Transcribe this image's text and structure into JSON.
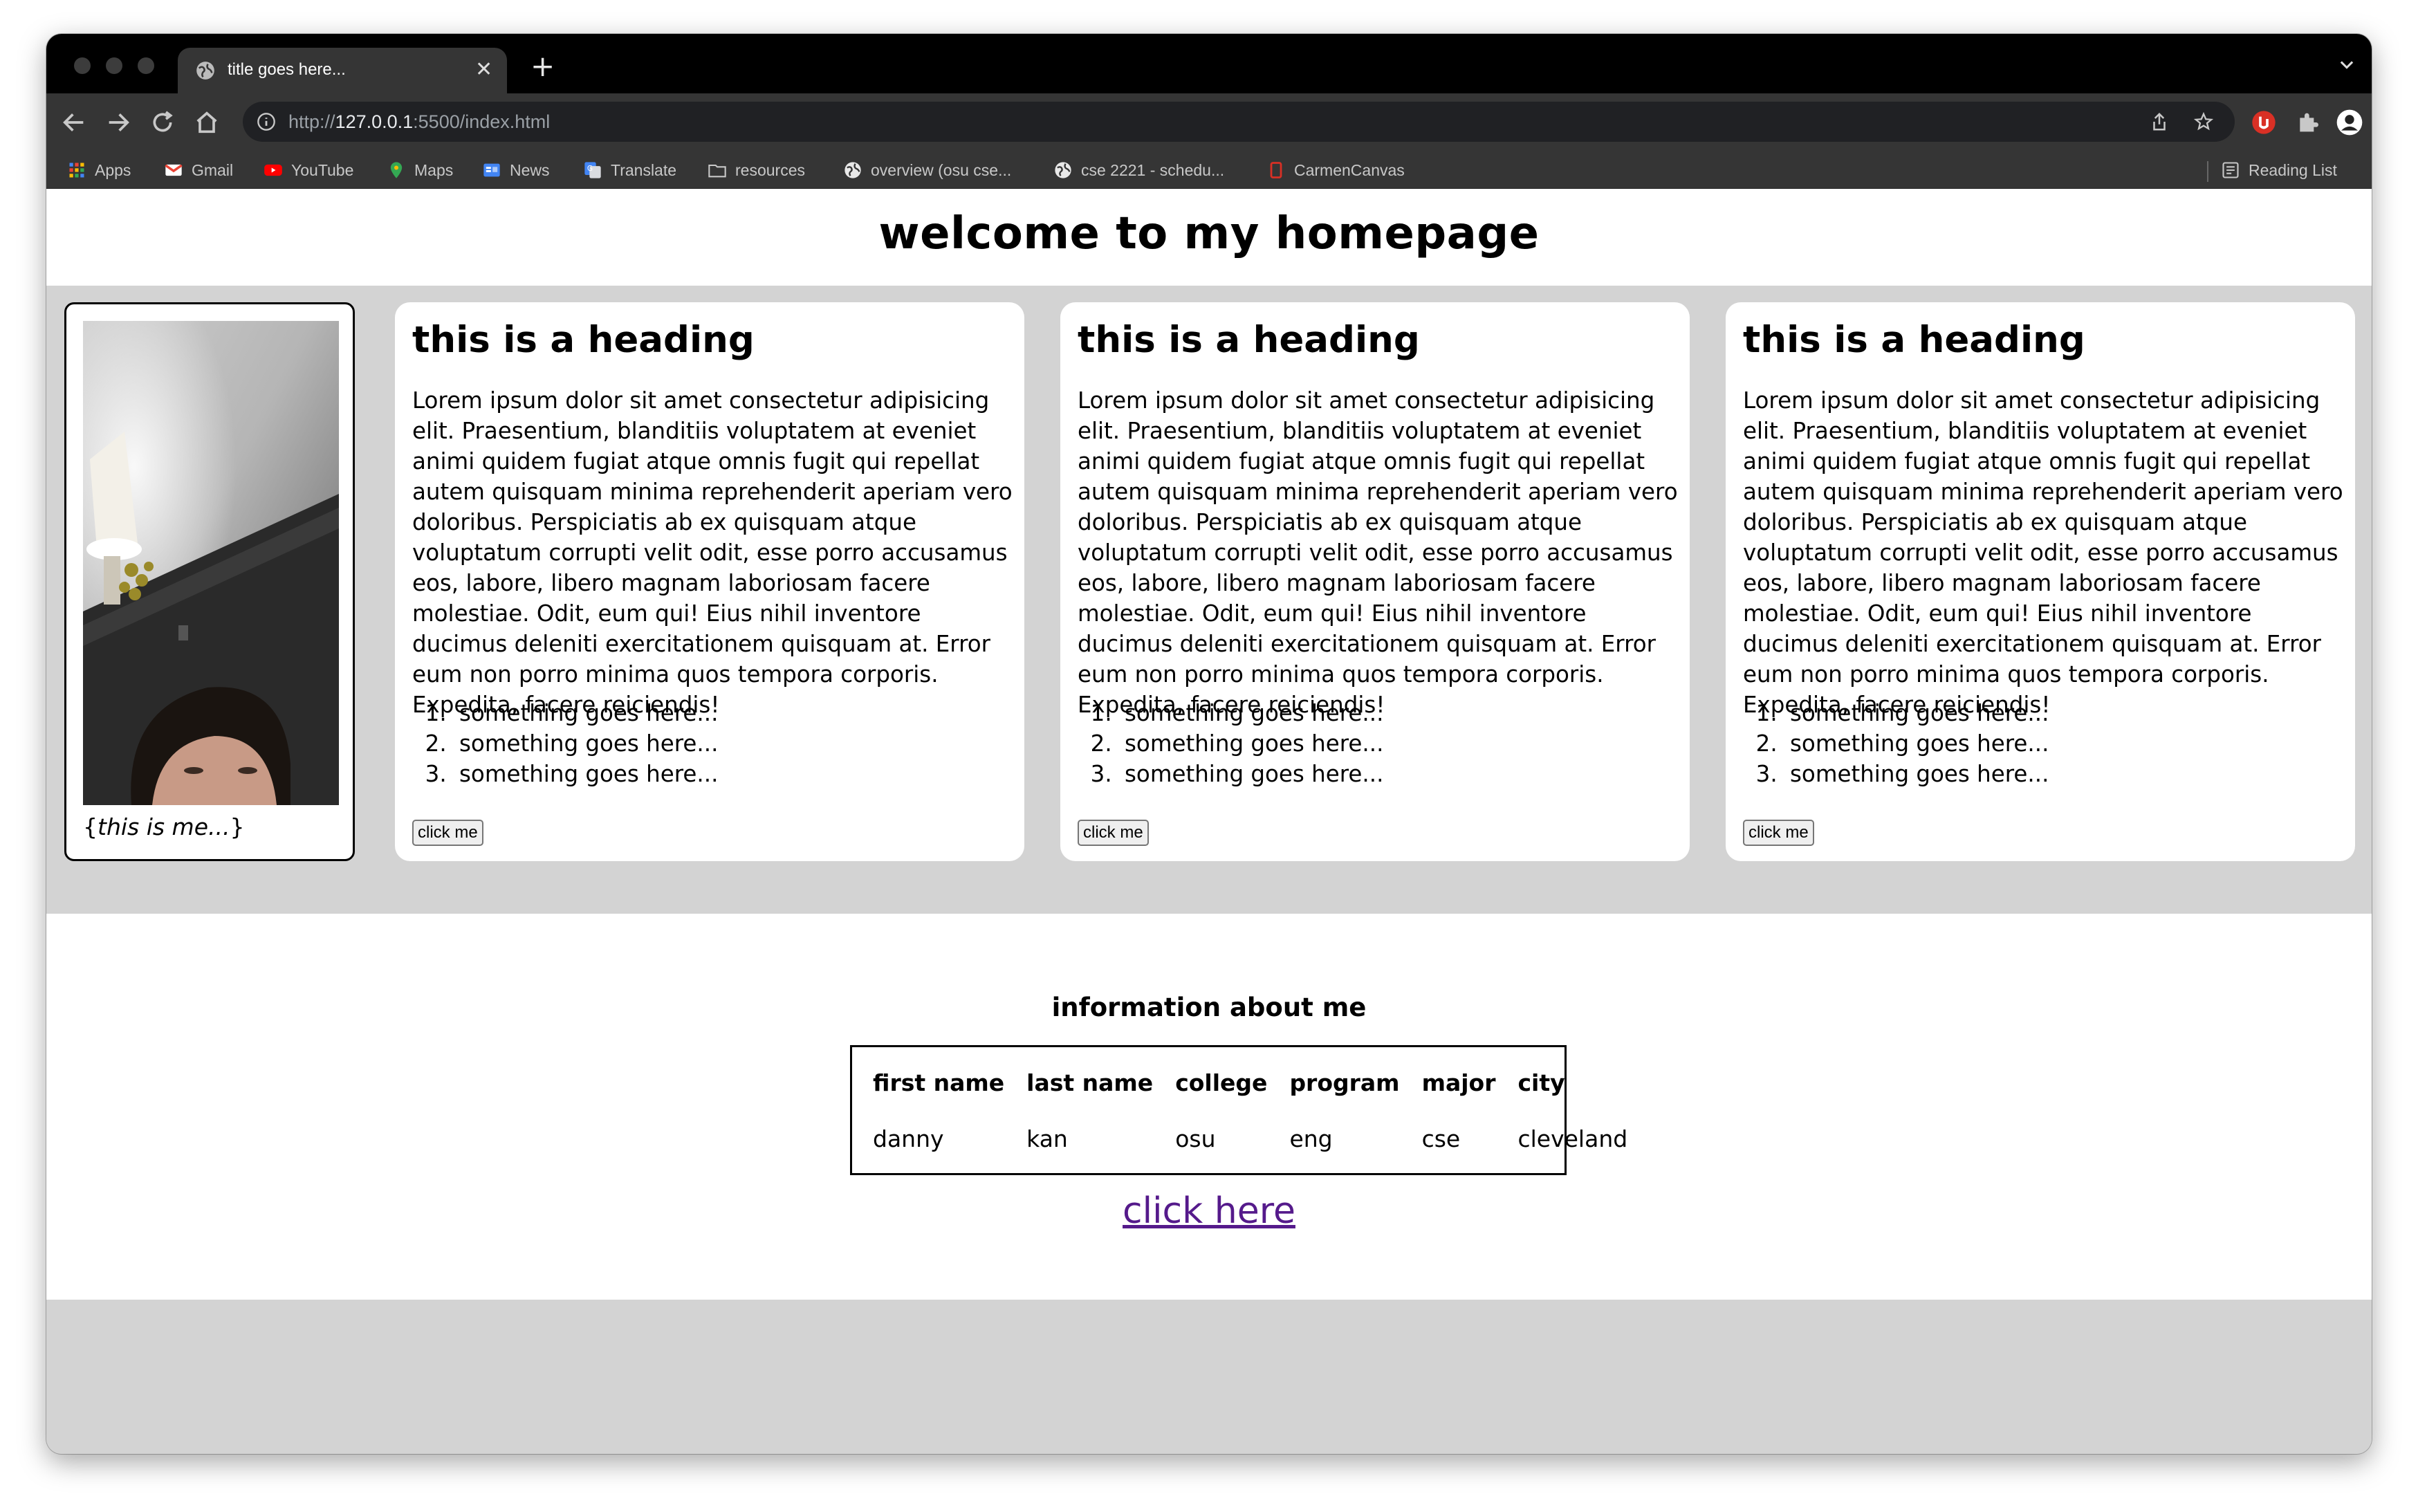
{
  "browser": {
    "tab_title": "title goes here...",
    "url_prefix": "http://",
    "url_host": "127.0.0.1",
    "url_rest": ":5500/index.html",
    "bookmarks": [
      {
        "label": "Apps",
        "icon": "apps-grid-icon"
      },
      {
        "label": "Gmail",
        "icon": "gmail-icon"
      },
      {
        "label": "YouTube",
        "icon": "youtube-icon"
      },
      {
        "label": "Maps",
        "icon": "maps-icon"
      },
      {
        "label": "News",
        "icon": "news-icon"
      },
      {
        "label": "Translate",
        "icon": "translate-icon"
      },
      {
        "label": "resources",
        "icon": "folder-icon"
      },
      {
        "label": "overview (osu cse...",
        "icon": "globe-icon"
      },
      {
        "label": "cse 2221 - schedu...",
        "icon": "globe-icon"
      },
      {
        "label": "CarmenCanvas",
        "icon": "canvas-icon"
      }
    ],
    "reading_list": "Reading List"
  },
  "page": {
    "title": "welcome to my homepage",
    "profile": {
      "caption_open": "{",
      "caption_text": "this is me...",
      "caption_close": "}"
    },
    "cards": [
      {
        "heading": "this is a heading",
        "body": "Lorem ipsum dolor sit amet consectetur adipisicing elit. Praesentium, blanditiis voluptatem at eveniet animi quidem fugiat atque omnis fugit qui repellat autem quisquam minima reprehenderit aperiam vero doloribus. Perspiciatis ab ex quisquam atque voluptatum corrupti velit odit, esse porro accusamus eos, labore, libero magnam laboriosam facere molestiae. Odit, eum qui! Eius nihil inventore ducimus deleniti exercitationem quisquam at. Error eum non porro minima quos tempora corporis. Expedita, facere reiciendis!",
        "items": [
          "something goes here...",
          "something goes here...",
          "something goes here..."
        ],
        "button": "click me"
      },
      {
        "heading": "this is a heading",
        "body": "Lorem ipsum dolor sit amet consectetur adipisicing elit. Praesentium, blanditiis voluptatem at eveniet animi quidem fugiat atque omnis fugit qui repellat autem quisquam minima reprehenderit aperiam vero doloribus. Perspiciatis ab ex quisquam atque voluptatum corrupti velit odit, esse porro accusamus eos, labore, libero magnam laboriosam facere molestiae. Odit, eum qui! Eius nihil inventore ducimus deleniti exercitationem quisquam at. Error eum non porro minima quos tempora corporis. Expedita, facere reiciendis!",
        "items": [
          "something goes here...",
          "something goes here...",
          "something goes here..."
        ],
        "button": "click me"
      },
      {
        "heading": "this is a heading",
        "body": "Lorem ipsum dolor sit amet consectetur adipisicing elit. Praesentium, blanditiis voluptatem at eveniet animi quidem fugiat atque omnis fugit qui repellat autem quisquam minima reprehenderit aperiam vero doloribus. Perspiciatis ab ex quisquam atque voluptatum corrupti velit odit, esse porro accusamus eos, labore, libero magnam laboriosam facere molestiae. Odit, eum qui! Eius nihil inventore ducimus deleniti exercitationem quisquam at. Error eum non porro minima quos tempora corporis. Expedita, facere reiciendis!",
        "items": [
          "something goes here...",
          "something goes here...",
          "something goes here..."
        ],
        "button": "click me"
      }
    ],
    "info": {
      "heading": "information about me",
      "columns": [
        "first name",
        "last name",
        "college",
        "program",
        "major",
        "city"
      ],
      "row": [
        "danny",
        "kan",
        "osu",
        "eng",
        "cse",
        "cleveland"
      ]
    },
    "link": "click here"
  }
}
